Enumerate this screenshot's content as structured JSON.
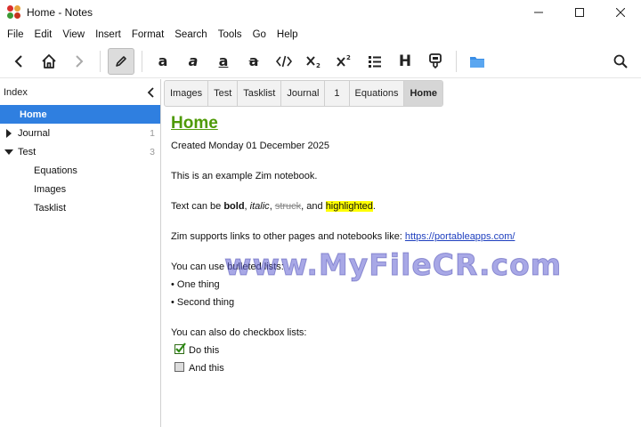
{
  "window": {
    "title": "Home - Notes"
  },
  "menu": [
    "File",
    "Edit",
    "View",
    "Insert",
    "Format",
    "Search",
    "Tools",
    "Go",
    "Help"
  ],
  "toolbar": {
    "icons": [
      "back-icon",
      "home-icon",
      "forward-icon",
      "edit-icon",
      "bold-icon",
      "italic-icon",
      "underline-icon",
      "strike-icon",
      "code-icon",
      "subscript-icon",
      "superscript-icon",
      "bullet-list-icon",
      "heading-icon",
      "highlight-icon",
      "folder-icon",
      "search-icon"
    ],
    "accent": "#3a8ee6"
  },
  "sidebar": {
    "title": "Index",
    "items": [
      {
        "label": "Home",
        "count": "",
        "level": 0,
        "expander": "none",
        "selected": true
      },
      {
        "label": "Journal",
        "count": "1",
        "level": 0,
        "expander": "collapsed",
        "selected": false
      },
      {
        "label": "Test",
        "count": "3",
        "level": 0,
        "expander": "expanded",
        "selected": false
      },
      {
        "label": "Equations",
        "count": "",
        "level": 1,
        "expander": "none",
        "selected": false
      },
      {
        "label": "Images",
        "count": "",
        "level": 1,
        "expander": "none",
        "selected": false
      },
      {
        "label": "Tasklist",
        "count": "",
        "level": 1,
        "expander": "none",
        "selected": false
      }
    ],
    "selected_color": "#2f7fe0"
  },
  "pathbar": [
    "Images",
    "Test",
    "Tasklist",
    "Journal",
    "1",
    "Equations",
    "Home"
  ],
  "editor": {
    "heading": "Home",
    "created": "Created Monday 01 December 2025",
    "intro": "This is an example Zim notebook.",
    "format_line": {
      "prefix": "Text can be ",
      "bold": "bold",
      "sep1": ", ",
      "italic": "italic",
      "sep2": ", ",
      "struck": "struck",
      "sep3": ", and ",
      "highlighted": "highlighted",
      "suffix": "."
    },
    "links_line": {
      "text": "Zim supports links to other pages and notebooks like: ",
      "url": "https://portableapps.com/"
    },
    "bullets_intro": "You can use bulleted lists:",
    "bullets": [
      "• One thing",
      "• Second thing"
    ],
    "checkbox_intro": "You can also do checkbox lists:",
    "checkboxes": [
      {
        "label": "Do this",
        "checked": true
      },
      {
        "label": "And this",
        "checked": false
      }
    ],
    "heading_color": "#4e9a06",
    "link_color": "#1e3fbf",
    "highlight_color": "#ffff00"
  },
  "watermark": "www.MyFileCR.com"
}
